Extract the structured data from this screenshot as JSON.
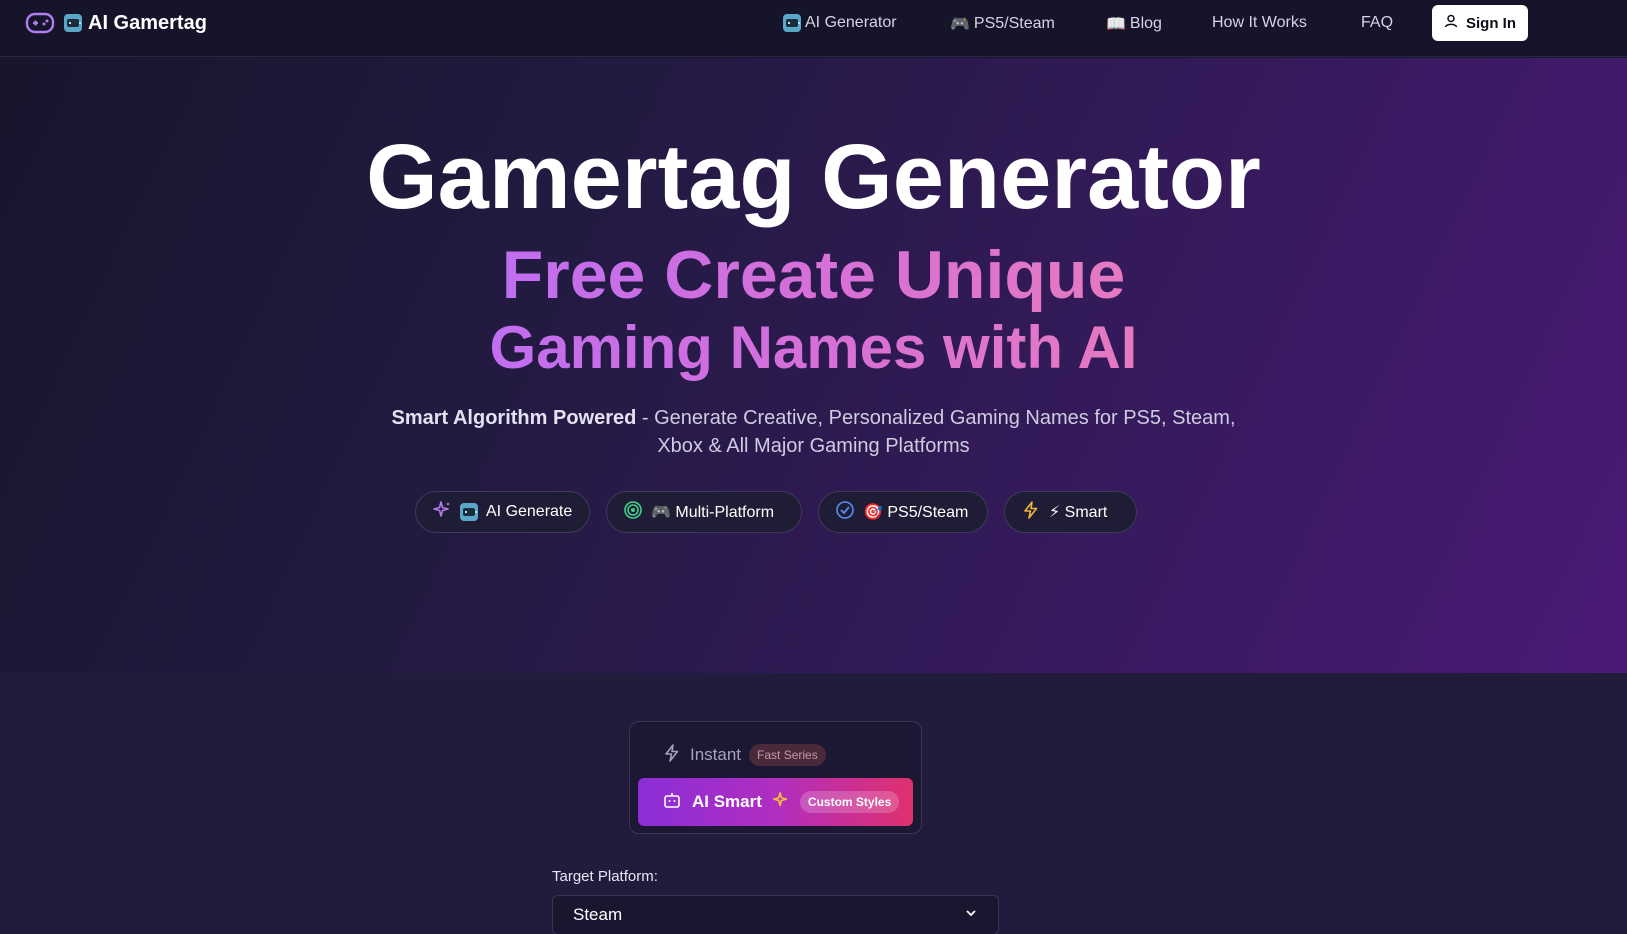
{
  "nav": {
    "brand": "AI Gamertag",
    "links": [
      {
        "label": "AI Generator",
        "emoji": "robot"
      },
      {
        "label": "PS5/Steam",
        "emoji": "🎮"
      },
      {
        "label": "Blog",
        "emoji": "📖"
      },
      {
        "label": "How It Works",
        "emoji": ""
      },
      {
        "label": "FAQ",
        "emoji": ""
      }
    ],
    "signin_label": "Sign In"
  },
  "hero": {
    "title": "Gamertag Generator",
    "subtitle_line1": "Free Create Unique",
    "subtitle_line2": "Gaming Names with AI",
    "desc_bold": "Smart Algorithm Powered",
    "desc_rest": " - Generate Creative, Personalized Gaming Names for PS5, Steam,",
    "desc_line2": "Xbox & All Major Gaming Platforms",
    "pills": [
      {
        "label": "AI Generate",
        "icon": "sparkles-icon",
        "color": "#b07cf0"
      },
      {
        "label": "🎮 Multi-Platform",
        "icon": "target-icon",
        "color": "#3fd08a"
      },
      {
        "label": "🎯 PS5/Steam",
        "icon": "check-circle-icon",
        "color": "#5a8ef0"
      },
      {
        "label": "⚡ Smart",
        "icon": "bolt-icon",
        "color": "#f0b43a"
      }
    ]
  },
  "generator": {
    "instant_label": "Instant",
    "instant_badge": "Fast Series",
    "ai_label": "AI Smart",
    "ai_badge": "Custom Styles",
    "platform_label": "Target Platform:",
    "platform_value": "Steam"
  },
  "colors": {
    "accent_purple": "#8a2ed8",
    "accent_pink": "#e0306e",
    "gradient_text_start": "#c06ef0",
    "gradient_text_end": "#e57ac0"
  }
}
